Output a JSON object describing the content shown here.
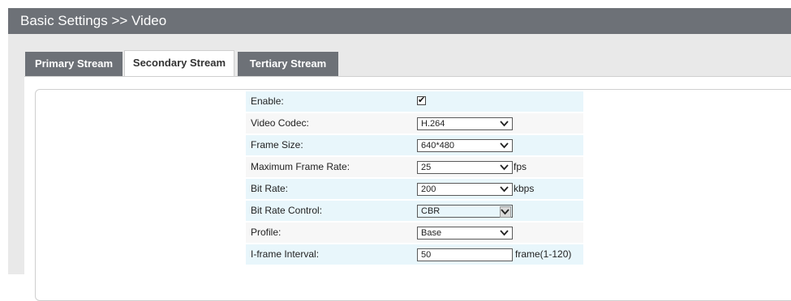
{
  "header": {
    "title": "Basic Settings >> Video"
  },
  "tabs": [
    {
      "label": "Primary Stream",
      "active": false
    },
    {
      "label": "Secondary Stream",
      "active": true
    },
    {
      "label": "Tertiary Stream",
      "active": false
    }
  ],
  "form": {
    "enable": {
      "label": "Enable:",
      "checked": true,
      "check_glyph": "✔"
    },
    "video_codec": {
      "label": "Video Codec:",
      "value": "H.264"
    },
    "frame_size": {
      "label": "Frame Size:",
      "value": "640*480"
    },
    "max_frame_rate": {
      "label": "Maximum Frame Rate:",
      "value": "25",
      "unit": "fps"
    },
    "bit_rate": {
      "label": "Bit Rate:",
      "value": "200",
      "unit": "kbps"
    },
    "bit_rate_control": {
      "label": "Bit Rate Control:",
      "value": "CBR"
    },
    "profile": {
      "label": "Profile:",
      "value": "Base"
    },
    "iframe_interval": {
      "label": "I-frame Interval:",
      "value": "50",
      "unit": "frame(1-120)"
    }
  },
  "colors": {
    "header_bg": "#6d7177",
    "row_highlight": "#e8f6fb",
    "row_plain": "#f7f7f7"
  },
  "icons": {
    "dropdown": "chevron-down-icon",
    "checkbox": "checkmark-icon"
  }
}
